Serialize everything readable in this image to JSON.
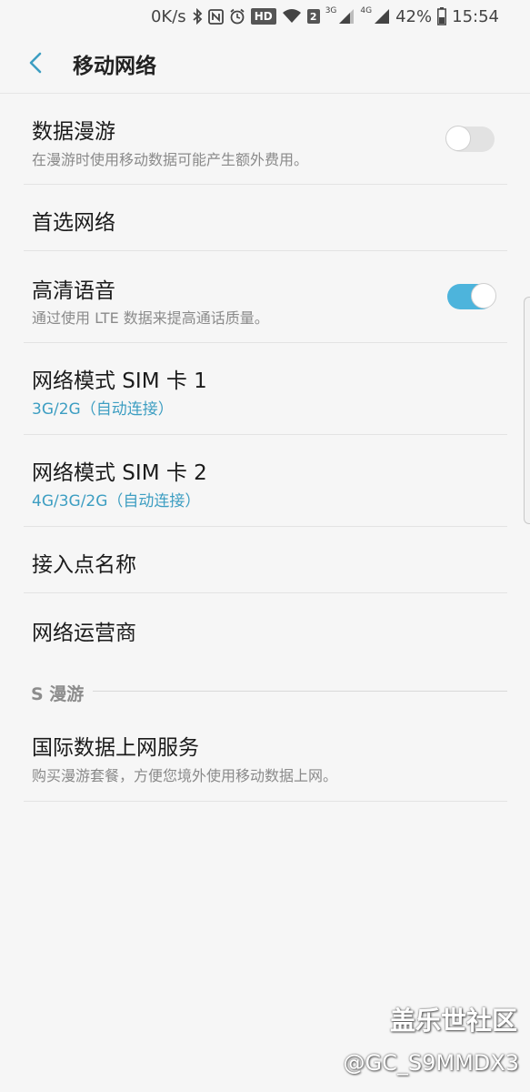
{
  "status_bar": {
    "speed": "0K/s",
    "hd": "HD",
    "sim_badge": "2",
    "net_tag_1": "3G",
    "net_tag_2": "4G",
    "battery": "42%",
    "time": "15:54"
  },
  "header": {
    "title": "移动网络"
  },
  "settings": [
    {
      "title": "数据漫游",
      "subtitle": "在漫游时使用移动数据可能产生额外费用。",
      "toggle": false
    },
    {
      "title": "首选网络"
    },
    {
      "title": "高清语音",
      "subtitle": "通过使用 LTE 数据来提高通话质量。",
      "toggle": true
    },
    {
      "title": "网络模式 SIM 卡 1",
      "subtitle": "3G/2G（自动连接）"
    },
    {
      "title": "网络模式 SIM 卡 2",
      "subtitle": "4G/3G/2G（自动连接）"
    },
    {
      "title": "接入点名称"
    },
    {
      "title": "网络运营商"
    }
  ],
  "section": {
    "header": "S 漫游",
    "items": [
      {
        "title": "国际数据上网服务",
        "subtitle": "购买漫游套餐，方便您境外使用移动数据上网。"
      }
    ]
  },
  "watermark": {
    "line1": "盖乐世社区",
    "line2": "@GC_S9MMDX3"
  },
  "colors": {
    "accent": "#3d9ec2",
    "toggle_on": "#4db4dc",
    "background": "#f6f6f6"
  }
}
